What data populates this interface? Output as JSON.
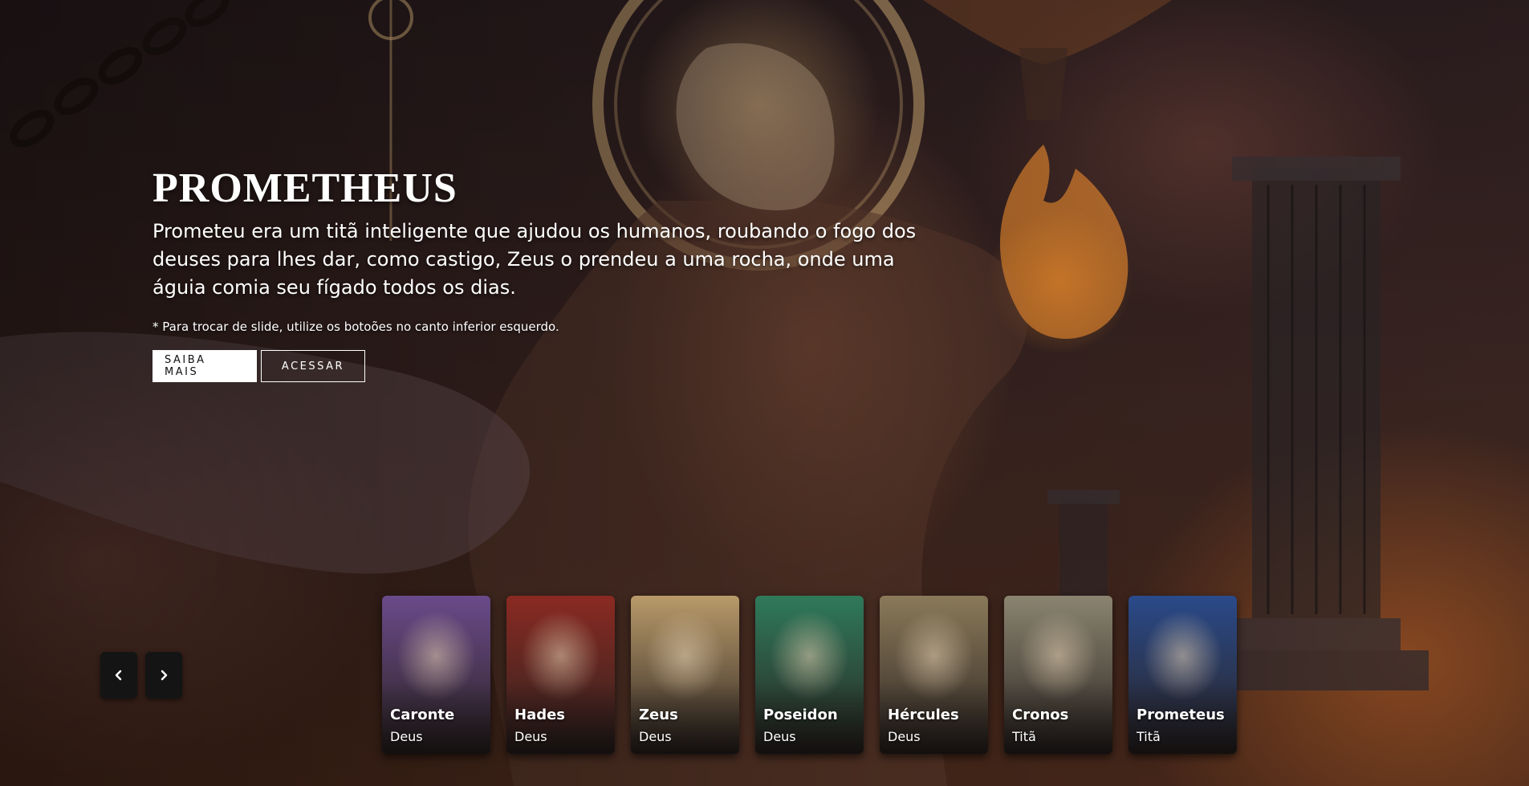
{
  "hero": {
    "title": "PROMETHEUS",
    "description": "Prometeu era um titã inteligente que ajudou os humanos, roubando o fogo dos deuses para lhes dar, como castigo, Zeus o prendeu a uma rocha, onde uma águia comia seu fígado todos os dias.",
    "note": "* Para trocar de slide, utilize os botoões no canto inferior esquerdo.",
    "primary_button": "SAIBA MAIS",
    "secondary_button": "ACESSAR"
  },
  "navigation": {
    "prev_icon": "chevron-left-icon",
    "next_icon": "chevron-right-icon"
  },
  "cards": [
    {
      "name": "Caronte",
      "type": "Deus",
      "color": "#6a4a8a"
    },
    {
      "name": "Hades",
      "type": "Deus",
      "color": "#8a2a22"
    },
    {
      "name": "Zeus",
      "type": "Deus",
      "color": "#b89a6a"
    },
    {
      "name": "Poseidon",
      "type": "Deus",
      "color": "#2f7a5a"
    },
    {
      "name": "Hércules",
      "type": "Deus",
      "color": "#8a7a5a"
    },
    {
      "name": "Cronos",
      "type": "Titã",
      "color": "#8a8470"
    },
    {
      "name": "Prometeus",
      "type": "Titã",
      "color": "#2a4a8a"
    }
  ]
}
